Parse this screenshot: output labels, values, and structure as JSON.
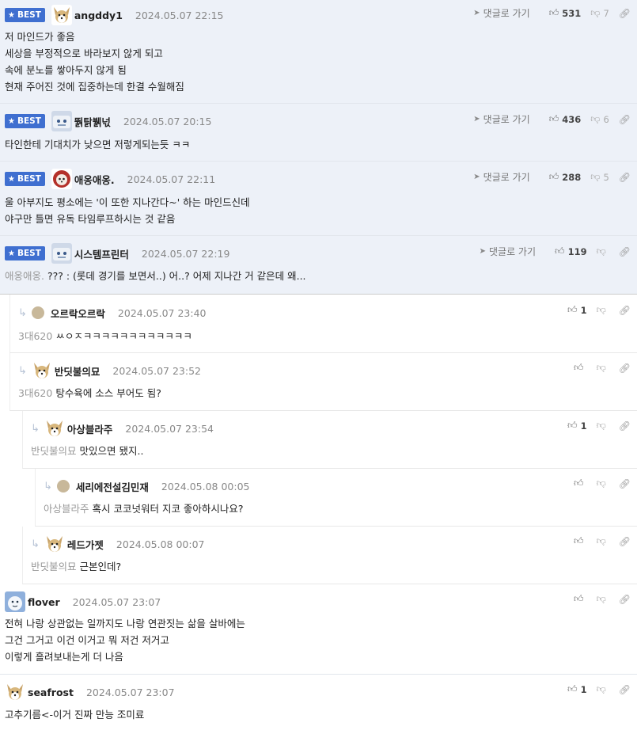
{
  "labels": {
    "best": "BEST",
    "goto": "댓글로 가기"
  },
  "icons": {
    "best_star": "star-icon",
    "thumbs_up": "thumbs-up-icon",
    "thumbs_down": "thumbs-down-icon",
    "link": "link-icon",
    "goto": "paper-plane-icon",
    "reply": "reply-arrow-icon"
  },
  "colors": {
    "best_badge": "#3f6fd0",
    "best_background": "#edf1f8",
    "tag_text": "#999999"
  },
  "comments": [
    {
      "best": true,
      "nick": "angddy1",
      "date": "2024.05.07 22:15",
      "up": "531",
      "down": "7",
      "lines": [
        "저 마인드가 좋음",
        "세상을 부정적으로 바라보지 않게 되고",
        "속에 분노를 쌓아두지 않게 됨",
        "현재 주어진 것에 집중하는데 한결 수월해짐"
      ]
    },
    {
      "best": true,
      "nick": "뛁탉뷁넋",
      "date": "2024.05.07 20:15",
      "up": "436",
      "down": "6",
      "lines": [
        "타인한테 기대치가 낮으면 저렇게되는듯 ㅋㅋ"
      ]
    },
    {
      "best": true,
      "nick": "애옹애옹.",
      "date": "2024.05.07 22:11",
      "up": "288",
      "down": "5",
      "lines": [
        "울 아부지도 평소에는 '이 또한 지나간다~' 하는 마인드신데",
        "야구만 틀면 유독 타임루프하시는 것 같음"
      ]
    },
    {
      "best": true,
      "nick": "시스템프린터",
      "date": "2024.05.07 22:19",
      "up": "119",
      "down": "",
      "tag": "애옹애옹.",
      "lines": [
        "??? : (롯데 경기를 보면서..) 어..? 어제 지나간 거 같은데 왜..."
      ]
    },
    {
      "nick": "오르락오르락",
      "date": "2024.05.07 23:40",
      "up": "1",
      "down": "",
      "tag": "3대620",
      "lines": [
        "ㅆㅇㅈㅋㅋㅋㅋㅋㅋㅋㅋㅋㅋㅋㅋ"
      ]
    },
    {
      "nick": "반딧불의묘",
      "date": "2024.05.07 23:52",
      "up": "",
      "down": "",
      "tag": "3대620",
      "lines": [
        "탕수육에 소스 부어도 됨?"
      ]
    },
    {
      "nick": "아상블라주",
      "date": "2024.05.07 23:54",
      "up": "1",
      "down": "",
      "tag": "반딧불의묘",
      "lines": [
        "맛있으면 됐지.."
      ]
    },
    {
      "nick": "세리에전설김민재",
      "date": "2024.05.08 00:05",
      "up": "",
      "down": "",
      "tag": "아상블라주",
      "lines": [
        "혹시 코코넛워터 지코 좋아하시나요?"
      ]
    },
    {
      "nick": "레드가젯",
      "date": "2024.05.08 00:07",
      "up": "",
      "down": "",
      "tag": "반딧불의묘",
      "lines": [
        "근본인데?"
      ]
    },
    {
      "nick": "flover",
      "date": "2024.05.07 23:07",
      "up": "",
      "down": "",
      "lines": [
        "전혀 나랑 상관없는 일까지도 나랑 연관짓는 삶을 살바에는",
        "그건 그거고 이건 이거고 뭐 저건 저거고",
        "이렇게 흘려보내는게 더 나음"
      ]
    },
    {
      "nick": "seafrost",
      "date": "2024.05.07 23:07",
      "up": "1",
      "down": "",
      "lines": [
        "고추기름<-이거 진짜 만능 조미료"
      ]
    }
  ]
}
